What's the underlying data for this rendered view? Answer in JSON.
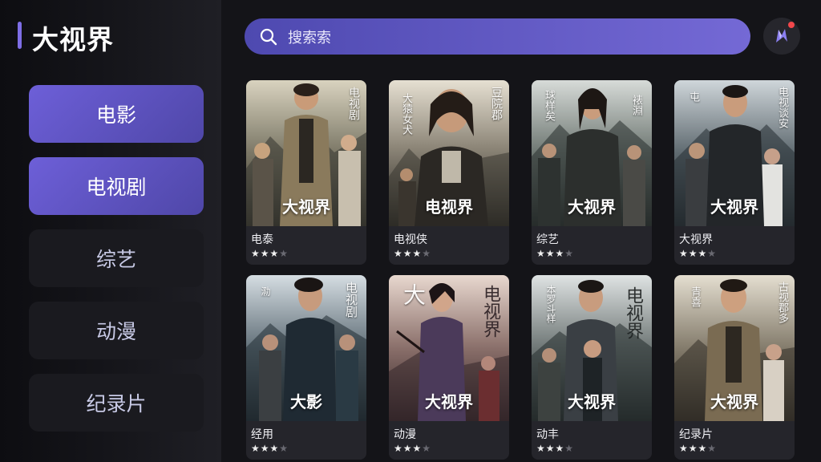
{
  "brand": "大视界",
  "search": {
    "placeholder": "搜索索"
  },
  "nav": [
    {
      "label": "电影",
      "active": true
    },
    {
      "label": "电视剧",
      "active": true
    },
    {
      "label": "综艺",
      "active": false
    },
    {
      "label": "动漫",
      "active": false
    },
    {
      "label": "纪录片",
      "active": false
    }
  ],
  "cards": [
    {
      "poster_title": "大视界",
      "name": "电泰",
      "rating": 3,
      "side_left": "",
      "side_right": "电视剧"
    },
    {
      "poster_title": "电视界",
      "name": "电视侠",
      "rating": 3,
      "side_left": "大猿女犬",
      "side_right": "豆院郡"
    },
    {
      "poster_title": "大视界",
      "name": "综艺",
      "rating": 3,
      "side_left": "球样矣",
      "side_right": "裱淵"
    },
    {
      "poster_title": "大视界",
      "name": "大视界",
      "rating": 3,
      "side_left": "屯",
      "side_right": "电视谈安"
    },
    {
      "poster_title": "大影",
      "name": "经用",
      "rating": 3,
      "side_left": "泐",
      "side_right": "电视剧"
    },
    {
      "poster_title": "大视界",
      "name": "动漫",
      "rating": 3,
      "side_left": "大",
      "side_right": "电视界"
    },
    {
      "poster_title": "大视界",
      "name": "动丰",
      "rating": 3,
      "side_left": "本罗斗样",
      "side_right": "电视界"
    },
    {
      "poster_title": "大视界",
      "name": "纪录片",
      "rating": 3,
      "side_left": "青喜",
      "side_right": "古视郡多"
    }
  ],
  "colors": {
    "accent": "#6d5fd8",
    "search_start": "#4e49b0",
    "search_end": "#7469d5",
    "badge": "#f2474b"
  }
}
